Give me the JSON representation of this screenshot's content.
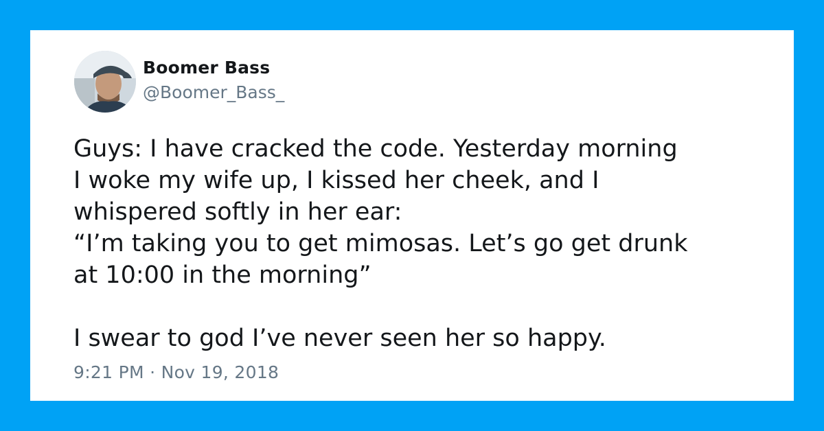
{
  "colors": {
    "background": "#00a2f5",
    "card": "#ffffff",
    "text_primary": "#14171a",
    "text_secondary": "#657786"
  },
  "author": {
    "display_name": "Boomer Bass",
    "handle": "@Boomer_Bass_",
    "avatar_icon": "user-avatar-photo"
  },
  "tweet": {
    "lines": [
      "Guys: I have cracked the code. Yesterday morning",
      "I woke my wife up, I kissed her cheek, and I",
      "whispered softly in her ear:",
      "“I’m taking you to get mimosas. Let’s go get drunk",
      "at 10:00 in the morning”"
    ],
    "closing_line": "I swear to god I’ve never seen her so happy.",
    "timestamp": "9:21 PM · Nov 19, 2018"
  }
}
